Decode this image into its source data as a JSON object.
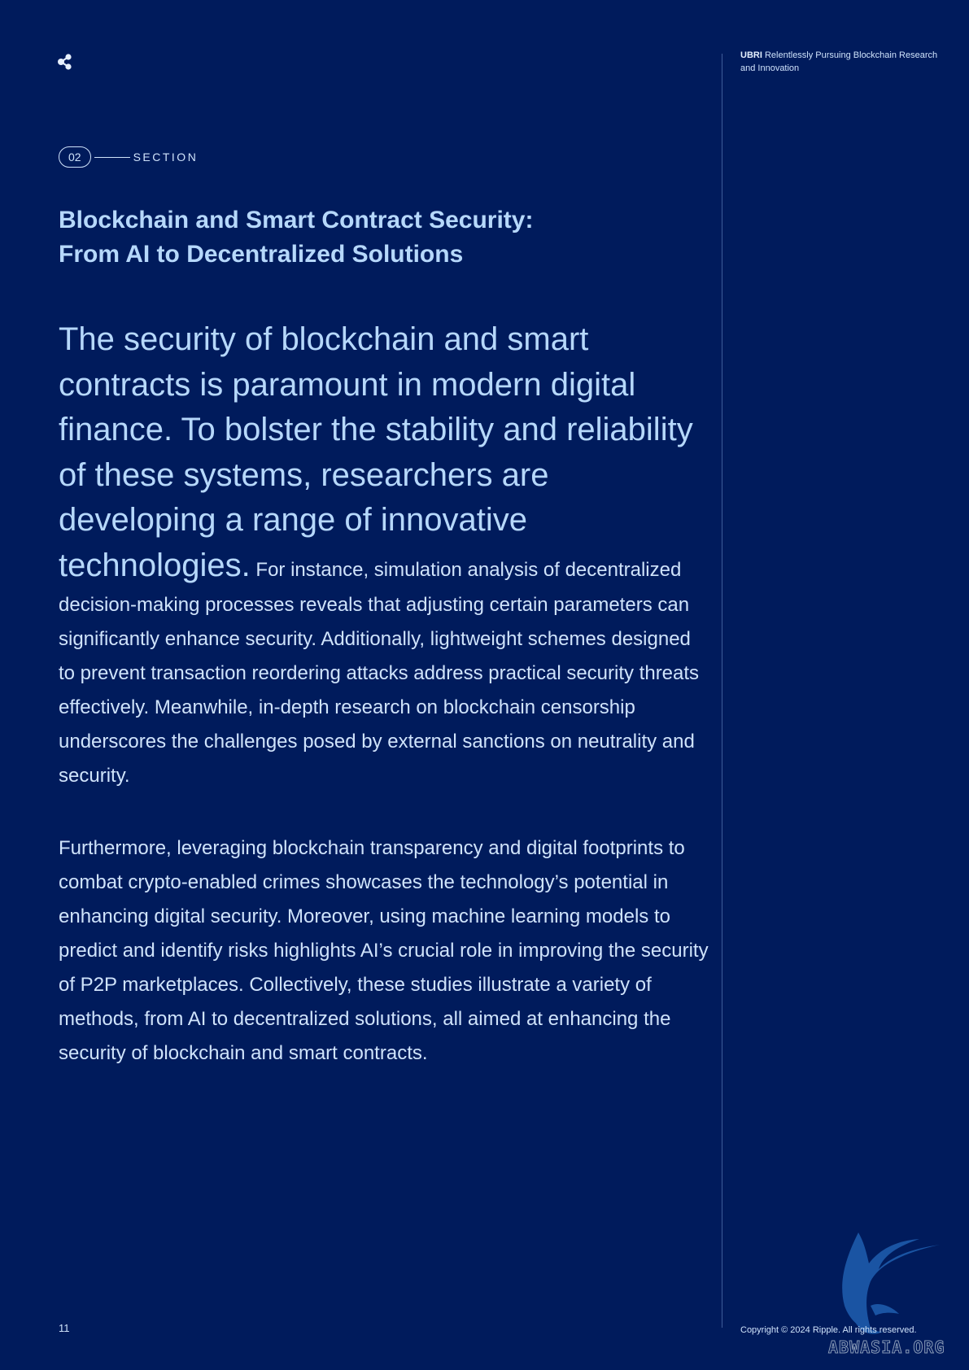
{
  "header": {
    "brand": "UBRI",
    "tagline": "Relentlessly Pursuing Blockchain Research and Innovation"
  },
  "section": {
    "number": "02",
    "label": "SECTION"
  },
  "title": {
    "line1": "Blockchain and Smart Contract Security:",
    "line2": "From AI to Decentralized Solutions"
  },
  "body": {
    "lead": "The security of blockchain and smart contracts is paramount in modern digital finance. To bolster the stability and reliability of these systems, researchers are developing a range of innovative technologies.",
    "paragraph1": "For instance, simulation analysis of decentralized decision-making processes reveals that adjusting certain parameters can significantly enhance security. Additionally, lightweight schemes designed to prevent transaction reordering attacks address practical security threats effectively. Meanwhile, in-depth research on blockchain censorship underscores the challenges posed by external sanctions on neutrality and security.",
    "paragraph2": "Furthermore, leveraging blockchain transparency and digital footprints to combat crypto-enabled crimes showcases the technology’s potential in enhancing digital security. Moreover, using machine learning models to predict and identify risks highlights AI’s crucial role in improving the security of P2P marketplaces. Collectively, these studies illustrate a variety of methods, from AI to decentralized solutions, all aimed at enhancing the security of blockchain and smart contracts."
  },
  "footer": {
    "page_number": "11",
    "copyright": "Copyright © 2024 Ripple. All rights reserved."
  },
  "watermark": {
    "text": "ABWASIA.ORG",
    "icon": "bird-watermark-icon"
  },
  "logo": {
    "icon": "ripple-logo-icon"
  },
  "colors": {
    "background": "#001b5c",
    "heading": "#b6d8fb",
    "text": "#cfe3fb",
    "divider": "#3f5c98"
  }
}
